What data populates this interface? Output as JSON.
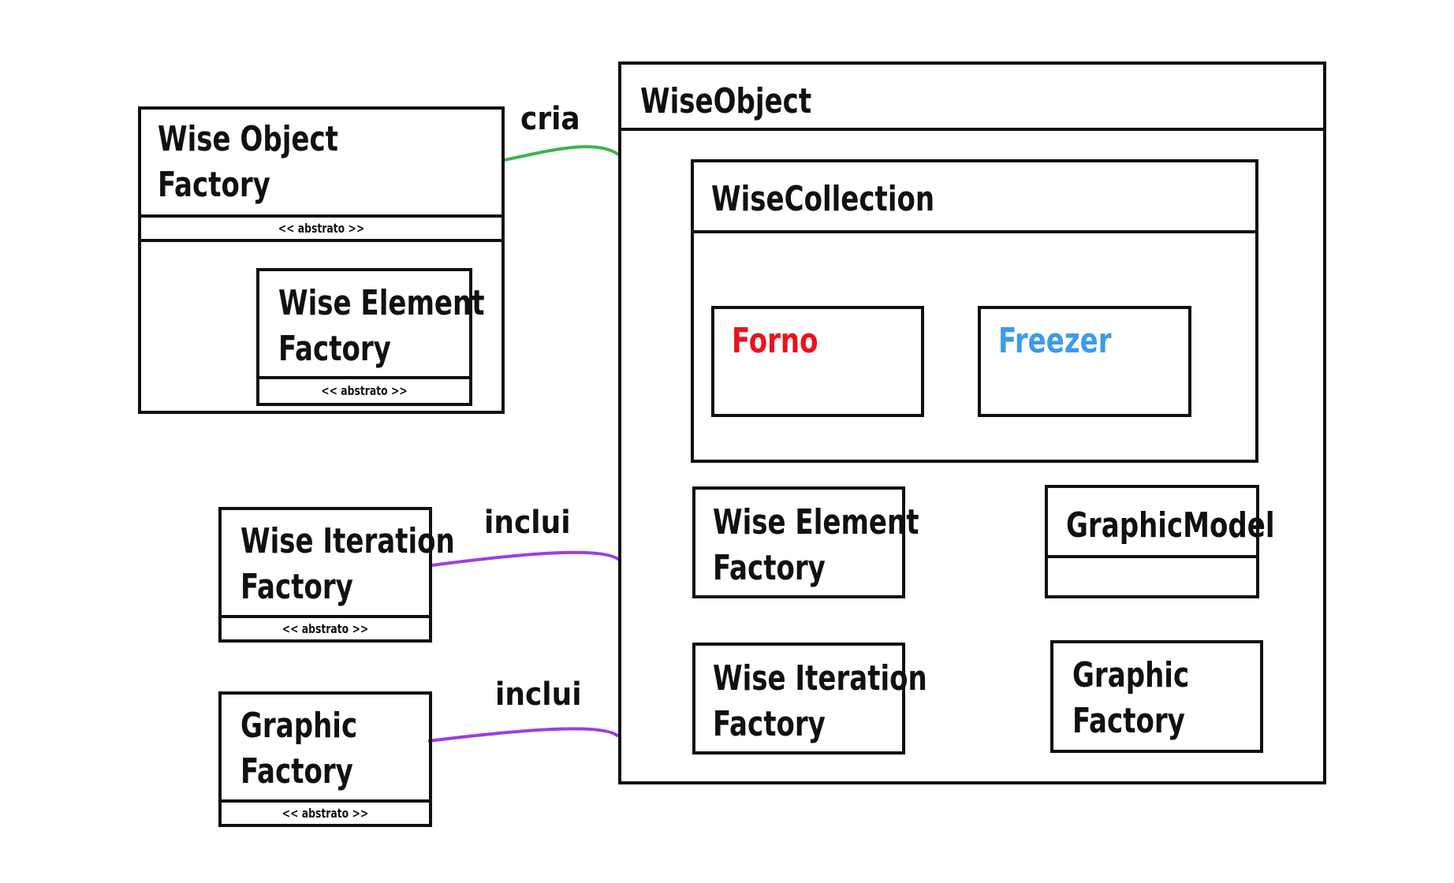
{
  "diagram": {
    "left": {
      "wise_object_factory": {
        "title_line1": "Wise Object",
        "title_line2": "Factory",
        "stereotype": "<< abstrato >>",
        "inner_wise_element_factory": {
          "title_line1": "Wise Element",
          "title_line2": "Factory",
          "stereotype": "<< abstrato >>"
        }
      },
      "wise_iteration_factory": {
        "title_line1": "Wise Iteration",
        "title_line2": "Factory",
        "stereotype": "<< abstrato >>"
      },
      "graphic_factory": {
        "title_line1": "Graphic",
        "title_line2": "Factory",
        "stereotype": "<< abstrato >>"
      }
    },
    "wise_object": {
      "title": "WiseObject",
      "wise_collection": {
        "title": "WiseCollection",
        "forno": "Forno",
        "freezer": "Freezer"
      },
      "wise_element_factory": {
        "title_line1": "Wise Element",
        "title_line2": "Factory"
      },
      "graphic_model": {
        "title": "GraphicModel"
      },
      "wise_iteration_factory": {
        "title_line1": "Wise Iteration",
        "title_line2": "Factory"
      },
      "graphic_factory": {
        "title_line1": "Graphic",
        "title_line2": "Factory"
      }
    },
    "relations": {
      "cria": "cria",
      "inclui_1": "inclui",
      "inclui_2": "inclui"
    },
    "colors": {
      "forno": "#e8141b",
      "freezer": "#3d9be9",
      "cria_line": "#3db54a",
      "inclui_line": "#9b3fe0"
    }
  }
}
